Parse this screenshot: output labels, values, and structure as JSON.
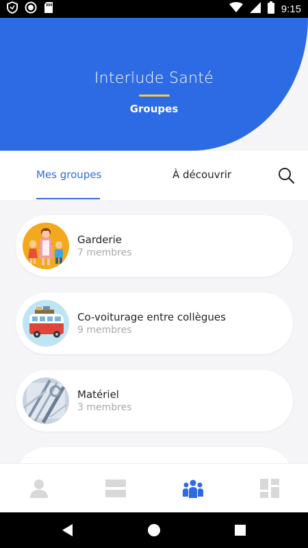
{
  "status_bar": {
    "time": "9:15",
    "icons": [
      "shield-icon",
      "record-icon",
      "sd-card-icon",
      "wifi-icon",
      "signal-icon",
      "battery-icon"
    ]
  },
  "header": {
    "title": "Interlude Santé",
    "subtitle": "Groupes",
    "background_color": "#2d6be4",
    "underline_color": "#f2c94c"
  },
  "tabs": {
    "items": [
      {
        "label": "Mes groupes",
        "active": true
      },
      {
        "label": "À découvrir",
        "active": false
      }
    ],
    "search_icon": "search-icon"
  },
  "groups": [
    {
      "name": "Garderie",
      "members": "7 membres",
      "avatar": "family-illustration"
    },
    {
      "name": "Co-voiturage entre collègues",
      "members": "9 membres",
      "avatar": "van-illustration"
    },
    {
      "name": "Matériel",
      "members": "3 membres",
      "avatar": "tools-photo"
    },
    {
      "name": "",
      "members": "",
      "avatar": ""
    }
  ],
  "bottom_nav": {
    "items": [
      {
        "icon": "person-icon",
        "active": false
      },
      {
        "icon": "feed-icon",
        "active": false
      },
      {
        "icon": "groups-icon",
        "active": true
      },
      {
        "icon": "dashboard-icon",
        "active": false
      }
    ],
    "active_color": "#2d6be4",
    "inactive_color": "#d8d8d8"
  },
  "system_nav": {
    "icons": [
      "back-icon",
      "home-icon",
      "recents-icon"
    ]
  }
}
